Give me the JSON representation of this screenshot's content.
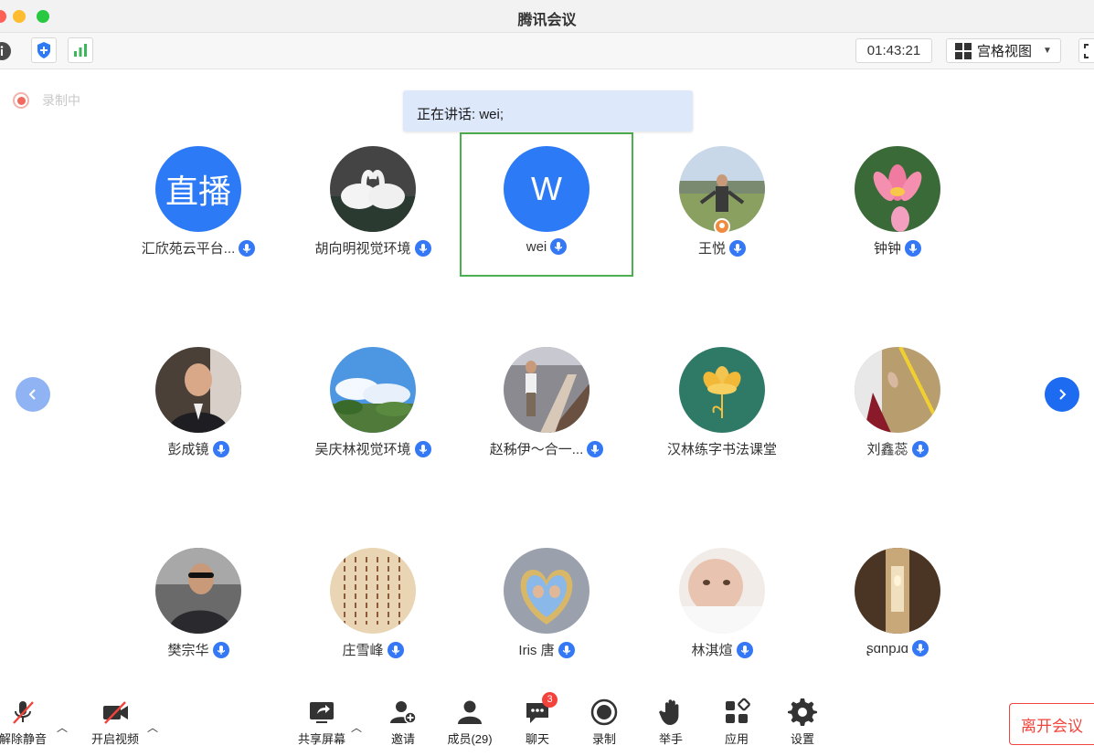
{
  "window": {
    "title": "腾讯会议"
  },
  "toolbar": {
    "timer": "01:43:21",
    "view_label": "宫格视图"
  },
  "status": {
    "recording": "录制中",
    "speaking": "正在讲话: wei;"
  },
  "participants": [
    {
      "name": "汇欣苑云平台...",
      "avatar_text": "直播",
      "avatar_color": "#2d7af6"
    },
    {
      "name": "胡向明视觉环境",
      "avatar_text": "",
      "avatar_color": "#6a6a6a"
    },
    {
      "name": "wei",
      "avatar_text": "W",
      "avatar_color": "#2d7af6"
    },
    {
      "name": "王悦",
      "avatar_text": "",
      "avatar_color": "#8aa67a"
    },
    {
      "name": "钟钟",
      "avatar_text": "",
      "avatar_color": "#5a8a4a"
    },
    {
      "name": "彭成镜",
      "avatar_text": "",
      "avatar_color": "#554a40"
    },
    {
      "name": "吴庆林视觉环境",
      "avatar_text": "",
      "avatar_color": "#5aa0e0"
    },
    {
      "name": "赵秭伊～合一...",
      "avatar_text": "",
      "avatar_color": "#7a6a5a"
    },
    {
      "name": "汉林练字书法课堂",
      "avatar_text": "",
      "avatar_color": "#2f7a68"
    },
    {
      "name": "刘鑫蕊",
      "avatar_text": "",
      "avatar_color": "#b59a6a"
    },
    {
      "name": "樊宗华",
      "avatar_text": "",
      "avatar_color": "#5a5a5a"
    },
    {
      "name": "庄雪峰",
      "avatar_text": "",
      "avatar_color": "#e6d2b0"
    },
    {
      "name": "Iris 唐",
      "avatar_text": "",
      "avatar_color": "#9a9aa8"
    },
    {
      "name": "林淇煊",
      "avatar_text": "",
      "avatar_color": "#e8c8b8"
    },
    {
      "name": "ʂɑnpɹɑ",
      "avatar_text": "",
      "avatar_color": "#6a4a32"
    }
  ],
  "controls": {
    "unmute": "解除静音",
    "start_video": "开启视频",
    "share_screen": "共享屏幕",
    "invite": "邀请",
    "members": "成员(29)",
    "chat": "聊天",
    "chat_badge": "3",
    "record": "录制",
    "raise_hand": "举手",
    "apps": "应用",
    "settings": "设置",
    "leave": "离开会议"
  },
  "colors": {
    "accent": "#2d7af6",
    "active_border": "#4caf50",
    "danger": "#f2443b"
  },
  "icons": [
    "info-icon",
    "shield-icon",
    "signal-icon",
    "grid-view-icon",
    "fullscreen-icon",
    "mic-icon",
    "camera-off-icon",
    "share-icon",
    "invite-icon",
    "members-icon",
    "chat-icon",
    "record-icon",
    "hand-icon",
    "apps-icon",
    "settings-icon"
  ]
}
